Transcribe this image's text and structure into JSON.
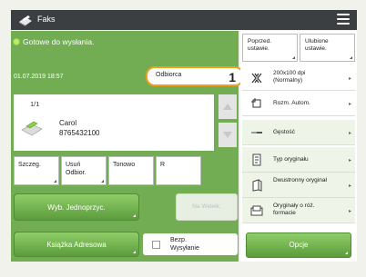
{
  "app": {
    "title": "Faks"
  },
  "status": {
    "text": "Gotowe do wysłania.",
    "color": "#72ad54"
  },
  "job": {
    "datetime": "01.07.2019 18:57",
    "recipient_label": "Odbiorca",
    "recipient_count": "1",
    "page": "1/1",
    "name": "Carol",
    "number": "8765432100"
  },
  "small_buttons": [
    "Szczeg.",
    "Usuń Odbior.",
    "Tonowo",
    "R"
  ],
  "buttons": {
    "specify": "Wyb. Jednoprzyc.",
    "disabled": "Na Widelk.",
    "address_book": "Książka Adresowa",
    "direct_send": "Bezp. Wysyłanie",
    "options": "Opcje"
  },
  "right_panel": {
    "prev_settings": "Poprzed. ustawie.",
    "fav_settings": "Ulubione ustawie.",
    "items": [
      {
        "label": "200x100 dpi (Normalny)",
        "icon": "resolution-icon"
      },
      {
        "label": "Rozm. Autom.",
        "icon": "scan-size-icon"
      },
      {
        "label": "Gęstość",
        "icon": "density-icon"
      },
      {
        "label": "Typ oryginału",
        "icon": "original-type-icon"
      },
      {
        "label": "Dwustronny oryginał",
        "icon": "two-sided-icon"
      },
      {
        "label": "Oryginały o róż. formacie",
        "icon": "different-size-icon"
      }
    ]
  },
  "accent": "#f0a01d"
}
